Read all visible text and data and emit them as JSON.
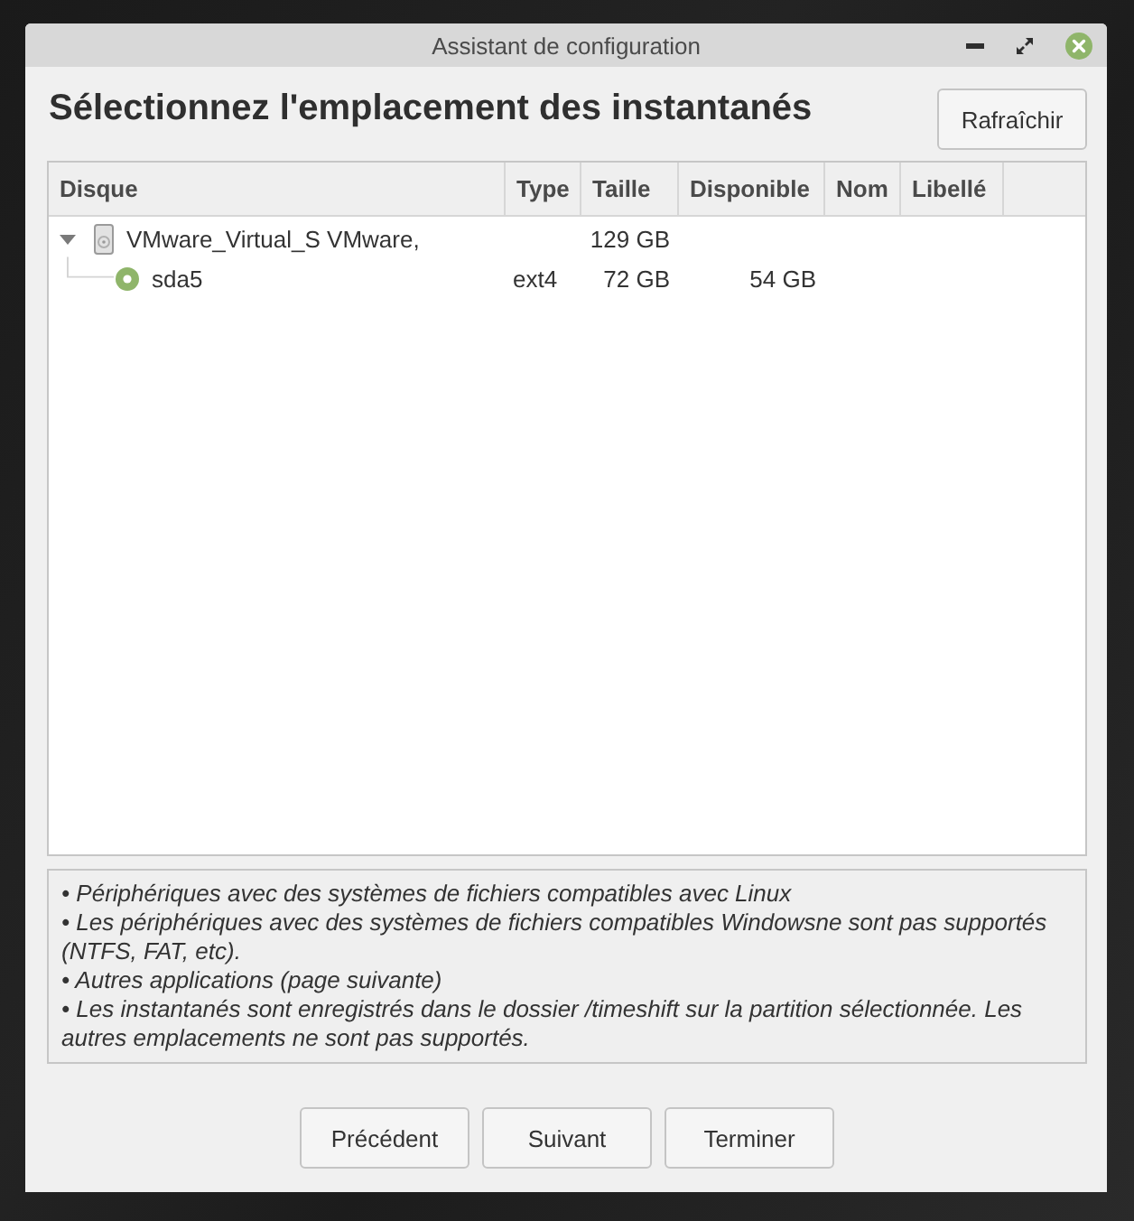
{
  "window": {
    "title": "Assistant de configuration"
  },
  "heading": "Sélectionnez l'emplacement des instantanés",
  "refresh_button": "Rafraîchir",
  "table": {
    "columns": [
      "Disque",
      "Type",
      "Taille",
      "Disponible",
      "Nom",
      "Libellé"
    ],
    "rows": [
      {
        "kind": "disk",
        "expanded": true,
        "name": "VMware_Virtual_S VMware,",
        "size": "129 GB",
        "children": [
          {
            "kind": "partition",
            "selected": true,
            "name": "sda5",
            "type": "ext4",
            "size": "72 GB",
            "free": "54 GB"
          }
        ]
      }
    ]
  },
  "notes": [
    "• Périphériques avec des systèmes de fichiers compatibles avec Linux",
    "• Les périphériques avec des systèmes de fichiers compatibles Windowsne sont pas supportés (NTFS, FAT, etc).",
    "• Autres applications (page suivante)",
    "• Les instantanés sont enregistrés dans le dossier /timeshift sur la partition sélectionnée. Les autres emplacements ne sont pas supportés."
  ],
  "buttons": [
    "Précédent",
    "Suivant",
    "Terminer"
  ]
}
